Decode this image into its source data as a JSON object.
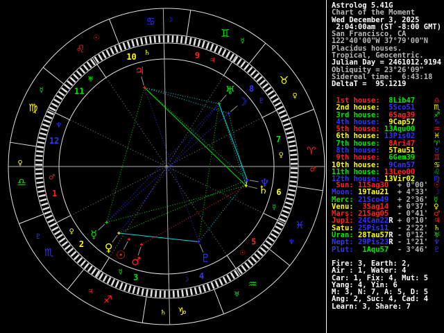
{
  "app": {
    "title": "Astrolog 5.41G"
  },
  "palette": {
    "red": "#ff2222",
    "yellow": "#ffff00",
    "green": "#00e800",
    "blue": "#3333ff",
    "cyan": "#00dcdc",
    "white": "#ffffff",
    "dim": "#b8b8b8",
    "wheel_line": "#e0e0e0",
    "axis": "#b0b0b0",
    "cusp_dotted": "#8a8a8a",
    "pointer": "#9a9a9a"
  },
  "panel": {
    "header_lines": [
      {
        "text": "Astrolog 5.41G",
        "bright": true
      },
      {
        "text": "Chart of the Moment",
        "bright": false
      },
      {
        "text": "Wed December 3, 2025",
        "bright": true
      },
      {
        "text": " 2:04:00am (ST -8:00 GMT)",
        "bright": true
      },
      {
        "text": "San Francisco, CA",
        "bright": false
      },
      {
        "text": "122°40'00\"W 37°79'00\"N",
        "bright": false
      },
      {
        "text": "Placidus houses.",
        "bright": false
      },
      {
        "text": "Tropical, Geocentric.",
        "bright": false
      },
      {
        "text": "Julian Day = 2461012.9194",
        "bright": true
      },
      {
        "text": "Obliquity = 23°26'09\"",
        "bright": false
      },
      {
        "text": "Sidereal time:  6:43:18",
        "bright": false
      },
      {
        "text": "DeltaT =  95.1219",
        "bright": true
      }
    ],
    "house_rows": [
      {
        "label": " 1st house:",
        "value": "8Lib47",
        "label_color": "red",
        "value_color": "green",
        "glyph": "♎"
      },
      {
        "label": " 2nd house:",
        "value": "5Sco51",
        "label_color": "yellow",
        "value_color": "blue",
        "glyph": "♏"
      },
      {
        "label": " 3rd house:",
        "value": "6Sag39",
        "label_color": "green",
        "value_color": "red",
        "glyph": "♐"
      },
      {
        "label": " 4th house:",
        "value": "9Cap57",
        "label_color": "blue",
        "value_color": "yellow",
        "glyph": "♑"
      },
      {
        "label": " 5th house:",
        "value": "13Aqu00",
        "label_color": "red",
        "value_color": "green",
        "glyph": "♒"
      },
      {
        "label": " 6th house:",
        "value": "13Pis02",
        "label_color": "yellow",
        "value_color": "blue",
        "glyph": "♓"
      },
      {
        "label": " 7th house:",
        "value": "8Ari47",
        "label_color": "green",
        "value_color": "red",
        "glyph": "♈"
      },
      {
        "label": " 8th house:",
        "value": "5Tau51",
        "label_color": "blue",
        "value_color": "yellow",
        "glyph": "♉"
      },
      {
        "label": " 9th house:",
        "value": "6Gem39",
        "label_color": "red",
        "value_color": "green",
        "glyph": "♊"
      },
      {
        "label": "10th house:",
        "value": "9Can57",
        "label_color": "yellow",
        "value_color": "blue",
        "glyph": "♋"
      },
      {
        "label": "11th house:",
        "value": "13Leo00",
        "label_color": "green",
        "value_color": "red",
        "glyph": "♌"
      },
      {
        "label": "12th house:",
        "value": "13Vir02",
        "label_color": "blue",
        "value_color": "yellow",
        "glyph": "♍"
      }
    ],
    "planet_rows": [
      {
        "label": " Sun:",
        "value": "11Sag30",
        "retro": false,
        "vel": "+ 0°00'",
        "label_color": "red",
        "value_color": "red",
        "glyph": "☉"
      },
      {
        "label": "Moon:",
        "value": "19Tau21",
        "retro": false,
        "vel": "+ 4°33'",
        "label_color": "blue",
        "value_color": "yellow",
        "glyph": "☽"
      },
      {
        "label": "Merc:",
        "value": "21Sco49",
        "retro": false,
        "vel": "+ 2°36'",
        "label_color": "green",
        "value_color": "blue",
        "glyph": "☿"
      },
      {
        "label": "Venu:",
        "value": " 3Sag14",
        "retro": false,
        "vel": "+ 0°37'",
        "label_color": "yellow",
        "value_color": "red",
        "glyph": "♀"
      },
      {
        "label": "Mars:",
        "value": "21Sag05",
        "retro": false,
        "vel": "- 0°41'",
        "label_color": "red",
        "value_color": "red",
        "glyph": "♂"
      },
      {
        "label": "Jupi:",
        "value": "24Can22",
        "retro": true,
        "vel": "+ 0°10'",
        "label_color": "red",
        "value_color": "blue",
        "glyph": "♃"
      },
      {
        "label": "Satu:",
        "value": "25Pis11",
        "retro": false,
        "vel": "- 2°22'",
        "label_color": "yellow",
        "value_color": "blue",
        "glyph": "♄"
      },
      {
        "label": "Uran:",
        "value": "28Tau57",
        "retro": true,
        "vel": "- 0°12'",
        "label_color": "green",
        "value_color": "yellow",
        "glyph": "♅"
      },
      {
        "label": "Nept:",
        "value": "29Pis23",
        "retro": true,
        "vel": "- 1°21'",
        "label_color": "blue",
        "value_color": "blue",
        "glyph": "♆"
      },
      {
        "label": "Plut:",
        "value": " 1Aqu57",
        "retro": false,
        "vel": "- 3°46'",
        "label_color": "blue",
        "value_color": "green",
        "glyph": "♇"
      }
    ],
    "stats_lines": [
      "Fire: 3, Earth: 2,",
      "Air : 1, Water: 4",
      "Car: 1, Fix: 4, Mut: 5",
      "Yang: 4, Yin: 6",
      "M: 3, N: 7, A: 5, D: 5",
      "Ang: 2, Suc: 4, Cad: 4",
      "Learn: 3, Share: 7"
    ]
  },
  "chart_data": {
    "type": "astrology-wheel",
    "ascendant_deg": 188.783,
    "house_cusps_deg": [
      188.783,
      215.85,
      246.65,
      279.95,
      313.0,
      343.033,
      8.783,
      35.85,
      66.65,
      99.95,
      133.0,
      163.033
    ],
    "radii": {
      "outer": 228,
      "zodiac_inner": 190,
      "tick_inner": 178,
      "house_inner": 155,
      "aspect": 118,
      "sign_glyph": 210,
      "house_label": 166,
      "planet_glyph": 143.5
    },
    "signs": [
      {
        "name": "aries",
        "glyph": "♈",
        "color": "red",
        "ruler": {
          "name": "mars",
          "glyph": "♂",
          "color": "red"
        }
      },
      {
        "name": "taurus",
        "glyph": "♉",
        "color": "yellow",
        "ruler": {
          "name": "venus",
          "glyph": "♀",
          "color": "yellow"
        }
      },
      {
        "name": "gemini",
        "glyph": "♊",
        "color": "green",
        "ruler": {
          "name": "mercury",
          "glyph": "☿",
          "color": "green"
        }
      },
      {
        "name": "cancer",
        "glyph": "♋",
        "color": "blue",
        "ruler": {
          "name": "moon",
          "glyph": "☽",
          "color": "blue"
        }
      },
      {
        "name": "leo",
        "glyph": "♌",
        "color": "red",
        "ruler": {
          "name": "sun",
          "glyph": "☉",
          "color": "red"
        }
      },
      {
        "name": "virgo",
        "glyph": "♍",
        "color": "yellow",
        "ruler": {
          "name": "mercury",
          "glyph": "☿",
          "color": "green"
        }
      },
      {
        "name": "libra",
        "glyph": "♎",
        "color": "green",
        "ruler": {
          "name": "venus",
          "glyph": "♀",
          "color": "yellow"
        }
      },
      {
        "name": "scorpio",
        "glyph": "♏",
        "color": "blue",
        "ruler": {
          "name": "pluto",
          "glyph": "♇",
          "color": "blue"
        }
      },
      {
        "name": "sagittarius",
        "glyph": "♐",
        "color": "red",
        "ruler": {
          "name": "jupiter",
          "glyph": "♃",
          "color": "red"
        }
      },
      {
        "name": "capricorn",
        "glyph": "♑",
        "color": "yellow",
        "ruler": {
          "name": "saturn",
          "glyph": "♄",
          "color": "yellow"
        }
      },
      {
        "name": "aquarius",
        "glyph": "♒",
        "color": "green",
        "ruler": {
          "name": "uranus",
          "glyph": "♅",
          "color": "green"
        }
      },
      {
        "name": "pisces",
        "glyph": "♓",
        "color": "blue",
        "ruler": {
          "name": "neptune",
          "glyph": "♆",
          "color": "blue"
        }
      }
    ],
    "house_number_colors": [
      "red",
      "yellow",
      "green",
      "blue"
    ],
    "planets": [
      {
        "name": "sun",
        "glyph": "☉",
        "color": "red",
        "lon": 251.5,
        "retro": false
      },
      {
        "name": "moon",
        "glyph": "☽",
        "color": "blue",
        "lon": 49.35,
        "retro": false
      },
      {
        "name": "mercury",
        "glyph": "☿",
        "color": "green",
        "lon": 231.817,
        "retro": false
      },
      {
        "name": "venus",
        "glyph": "♀",
        "color": "yellow",
        "lon": 243.233,
        "retro": false
      },
      {
        "name": "mars",
        "glyph": "♂",
        "color": "red",
        "lon": 261.083,
        "retro": false
      },
      {
        "name": "jupiter",
        "glyph": "♃",
        "color": "red",
        "lon": 114.367,
        "retro": true
      },
      {
        "name": "saturn",
        "glyph": "♄",
        "color": "yellow",
        "lon": 355.183,
        "retro": false
      },
      {
        "name": "uranus",
        "glyph": "♅",
        "color": "green",
        "lon": 58.95,
        "retro": true
      },
      {
        "name": "neptune",
        "glyph": "♆",
        "color": "blue",
        "lon": 359.383,
        "retro": true
      },
      {
        "name": "pluto",
        "glyph": "♇",
        "color": "blue",
        "lon": 301.95,
        "retro": false
      }
    ],
    "aspects": [
      {
        "a": "saturn",
        "b": "neptune",
        "color": "yellow",
        "solid": true
      },
      {
        "a": "jupiter",
        "b": "saturn",
        "color": "green",
        "solid": true
      },
      {
        "a": "uranus",
        "b": "neptune",
        "color": "cyan",
        "solid": true
      },
      {
        "a": "venus",
        "b": "pluto",
        "color": "cyan",
        "solid": true
      },
      {
        "a": "jupiter",
        "b": "mercury",
        "color": "green",
        "solid": false
      },
      {
        "a": "jupiter",
        "b": "neptune",
        "color": "green",
        "solid": false
      },
      {
        "a": "venus",
        "b": "neptune",
        "color": "green",
        "solid": false
      },
      {
        "a": "uranus",
        "b": "pluto",
        "color": "green",
        "solid": false
      },
      {
        "a": "mercury",
        "b": "saturn",
        "color": "green",
        "solid": false
      },
      {
        "a": "neptune",
        "b": "pluto",
        "color": "cyan",
        "solid": false
      },
      {
        "a": "saturn",
        "b": "uranus",
        "color": "cyan",
        "solid": false
      },
      {
        "a": "jupiter",
        "b": "uranus",
        "color": "cyan",
        "solid": false
      },
      {
        "a": "moon",
        "b": "jupiter",
        "color": "cyan",
        "solid": false
      },
      {
        "a": "moon",
        "b": "saturn",
        "color": "cyan",
        "solid": false
      },
      {
        "a": "moon",
        "b": "mercury",
        "color": "blue",
        "solid": false
      },
      {
        "a": "mercury",
        "b": "uranus",
        "color": "blue",
        "solid": false
      },
      {
        "a": "venus",
        "b": "uranus",
        "color": "blue",
        "solid": false
      },
      {
        "a": "jupiter",
        "b": "pluto",
        "color": "blue",
        "solid": false
      },
      {
        "a": "mars",
        "b": "saturn",
        "color": "red",
        "solid": false
      }
    ]
  }
}
